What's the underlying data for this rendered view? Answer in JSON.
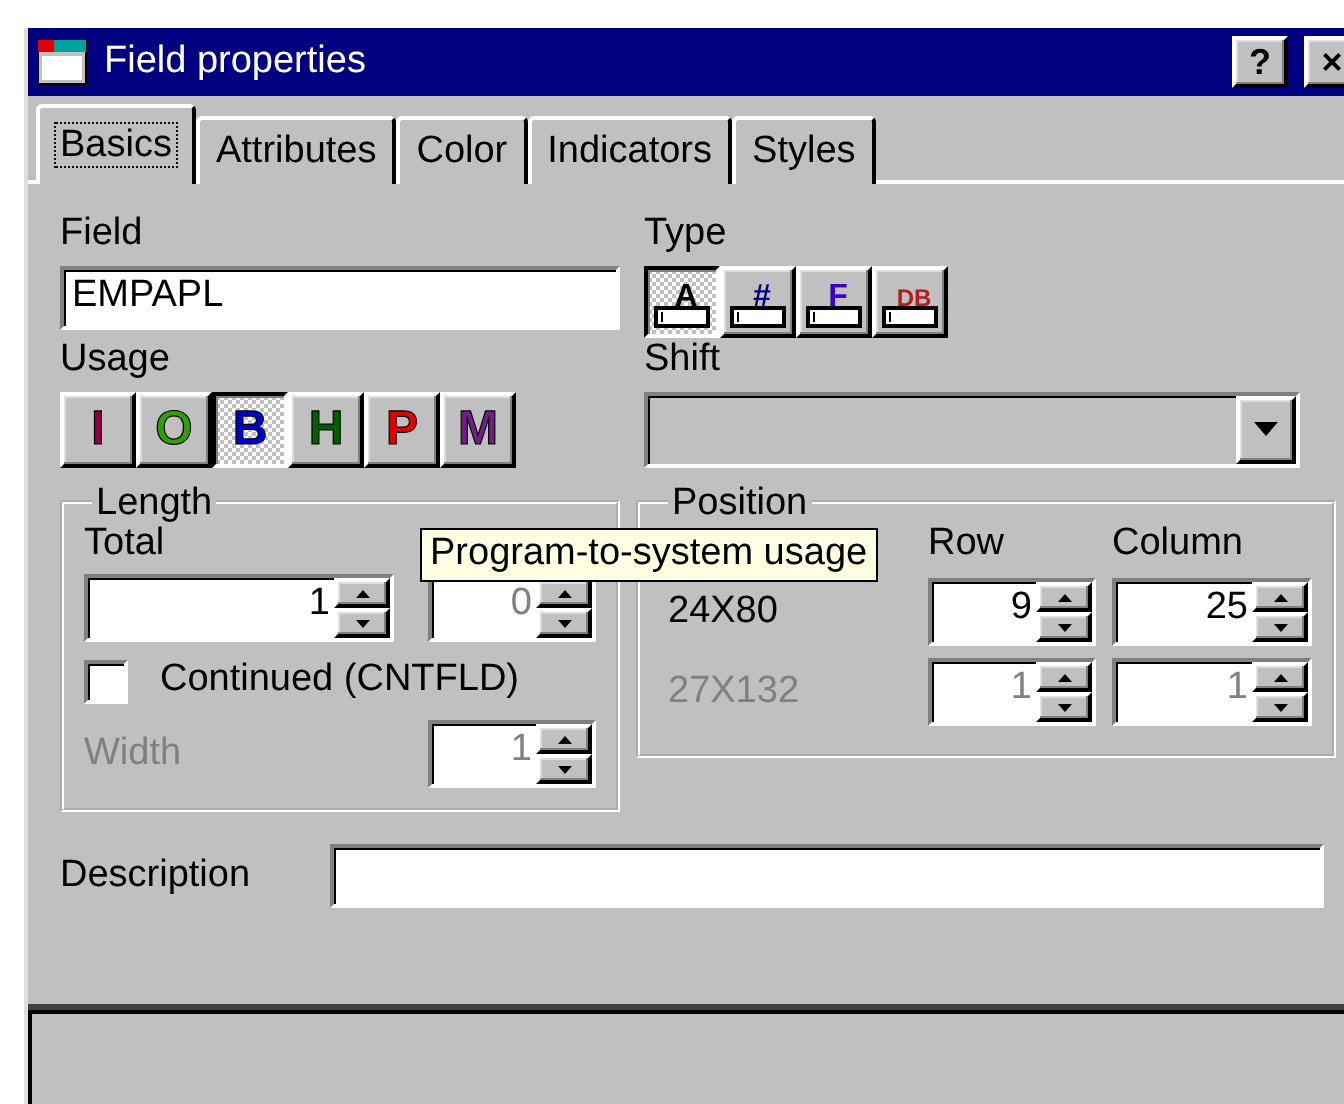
{
  "window": {
    "title": "Field properties",
    "help_button": "?",
    "close_button": "×"
  },
  "tabs": [
    {
      "label": "Basics",
      "selected": true
    },
    {
      "label": "Attributes",
      "selected": false
    },
    {
      "label": "Color",
      "selected": false
    },
    {
      "label": "Indicators",
      "selected": false
    },
    {
      "label": "Styles",
      "selected": false
    }
  ],
  "field": {
    "label": "Field",
    "value": "EMPAPL"
  },
  "type": {
    "label": "Type",
    "buttons": [
      {
        "glyph": "A",
        "color": "#000000",
        "selected": true
      },
      {
        "glyph": "#",
        "color": "#000080",
        "selected": false
      },
      {
        "glyph": "F",
        "color": "#4000c0",
        "selected": false
      },
      {
        "glyph": "DB",
        "color": "#b02020",
        "selected": false
      }
    ]
  },
  "usage": {
    "label": "Usage",
    "buttons": [
      {
        "letter": "I",
        "color": "#900040",
        "selected": false
      },
      {
        "letter": "O",
        "color": "#30a000",
        "selected": false
      },
      {
        "letter": "B",
        "color": "#0000d0",
        "selected": true
      },
      {
        "letter": "H",
        "color": "#006000",
        "selected": false
      },
      {
        "letter": "P",
        "color": "#e00000",
        "selected": false
      },
      {
        "letter": "M",
        "color": "#702080",
        "selected": false
      }
    ]
  },
  "shift": {
    "label": "Shift"
  },
  "length": {
    "legend": "Length",
    "total_label": "Total",
    "total": {
      "value": "1",
      "disabled": false
    },
    "decimals": {
      "value": "0",
      "disabled": true
    },
    "continued": {
      "label": "Continued (CNTFLD)",
      "checked": false
    },
    "width": {
      "label": "Width",
      "value": "1",
      "disabled": true
    }
  },
  "position": {
    "legend": "Position",
    "row_label": "Row",
    "column_label": "Column",
    "rows": [
      {
        "label": "24X80",
        "disabled": false,
        "row": "9",
        "column": "25"
      },
      {
        "label": "27X132",
        "disabled": true,
        "row": "1",
        "column": "1"
      }
    ]
  },
  "tooltip": "Program-to-system usage",
  "description": {
    "label": "Description"
  }
}
